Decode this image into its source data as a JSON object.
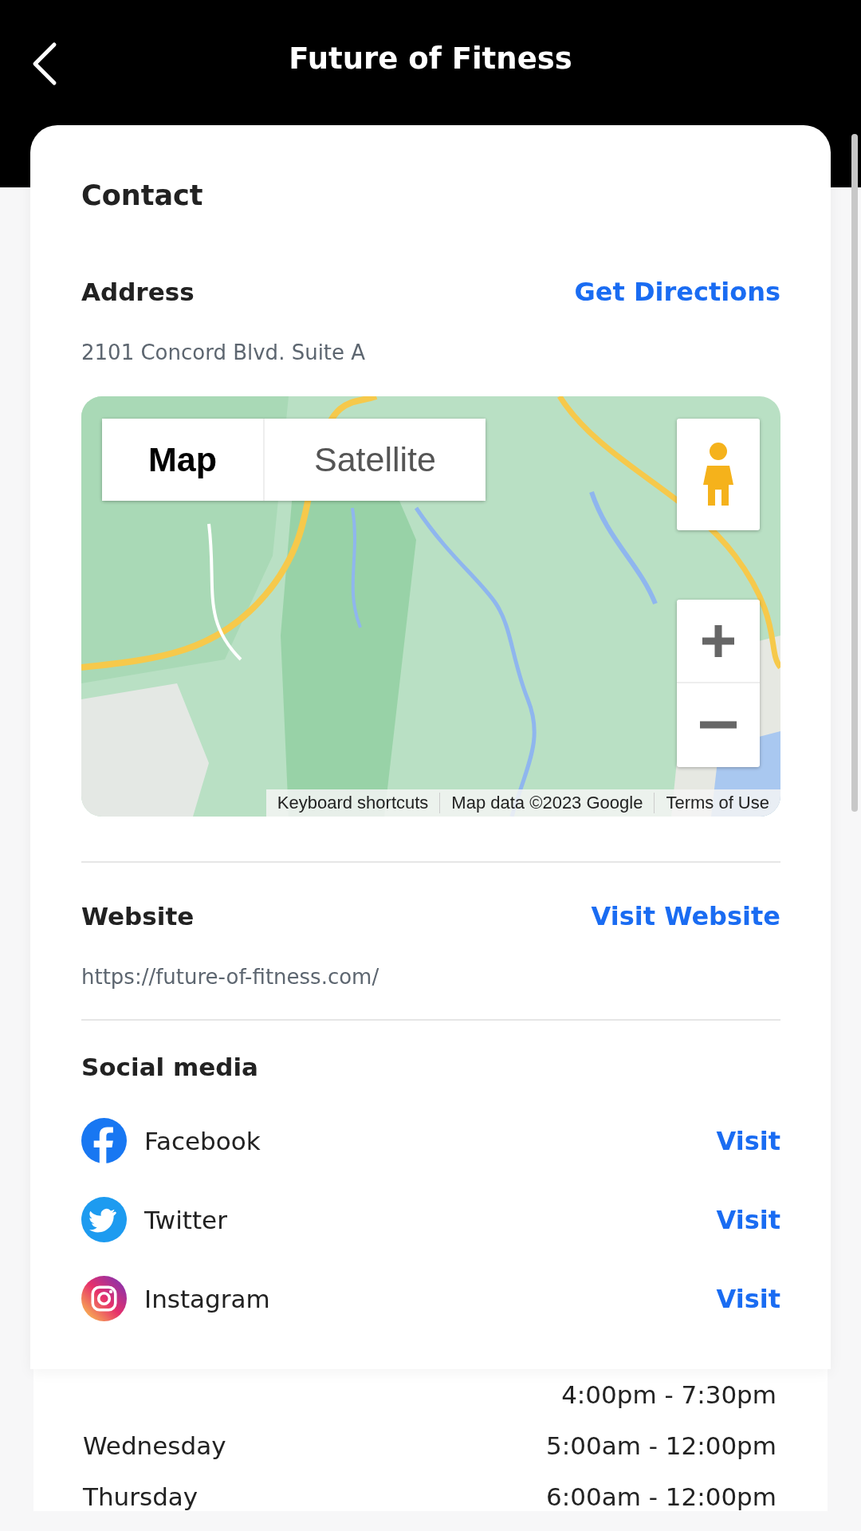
{
  "header": {
    "title": "Future of Fitness"
  },
  "contact": {
    "title": "Contact",
    "address": {
      "label": "Address",
      "action": "Get Directions",
      "value": "2101 Concord Blvd. Suite A"
    },
    "map": {
      "types": [
        {
          "label": "Map",
          "selected": true
        },
        {
          "label": "Satellite",
          "selected": false
        }
      ],
      "attribution": [
        "Keyboard shortcuts",
        "Map data ©2023 Google",
        "Terms of Use"
      ]
    },
    "website": {
      "label": "Website",
      "action": "Visit Website",
      "value": "https://future-of-fitness.com/"
    },
    "social": {
      "title": "Social media",
      "items": [
        {
          "kind": "facebook",
          "name": "Facebook",
          "action": "Visit"
        },
        {
          "kind": "twitter",
          "name": "Twitter",
          "action": "Visit"
        },
        {
          "kind": "instagram",
          "name": "Instagram",
          "action": "Visit"
        }
      ]
    }
  },
  "hours": [
    {
      "time": "4:00pm - 7:30pm"
    },
    {
      "day": "Wednesday",
      "time": "5:00am - 12:00pm"
    },
    {
      "day": "Thursday",
      "time": "6:00am - 12:00pm"
    }
  ]
}
